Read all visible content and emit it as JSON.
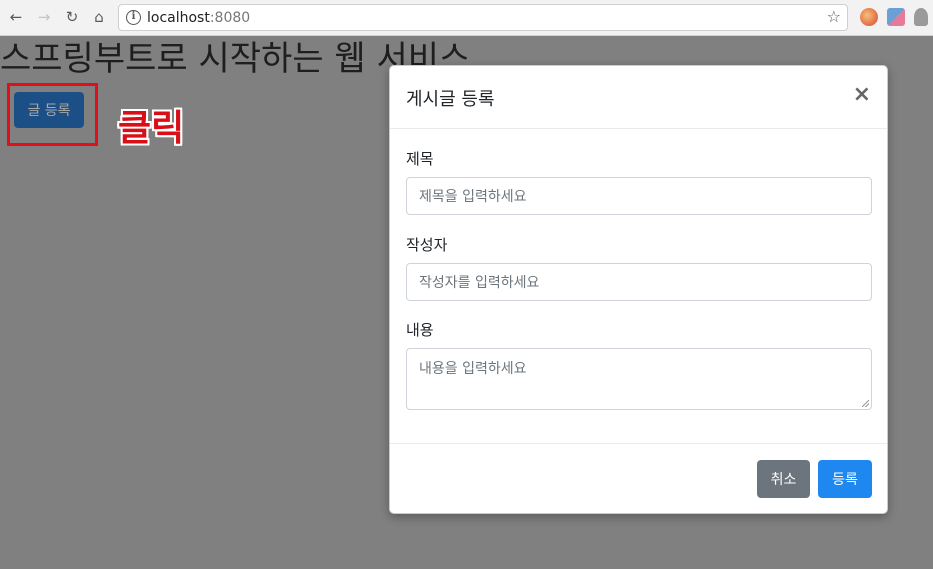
{
  "browser": {
    "url_host": "localhost",
    "url_port": ":8080",
    "back_icon": "←",
    "forward_icon": "→",
    "reload_icon": "↻",
    "home_icon": "⌂",
    "info_icon": "i",
    "star_icon": "☆"
  },
  "page": {
    "title": "스프링부트로 시작하는 웹 서비스",
    "write_button": "글 등록",
    "annotation": "클릭"
  },
  "modal": {
    "title": "게시글 등록",
    "close": "×",
    "fields": [
      {
        "label": "제목",
        "placeholder": "제목을 입력하세요"
      },
      {
        "label": "작성자",
        "placeholder": "작성자를 입력하세요"
      },
      {
        "label": "내용",
        "placeholder": "내용을 입력하세요"
      }
    ],
    "cancel_button": "취소",
    "submit_button": "등록"
  },
  "colors": {
    "overlay": "#808080",
    "primary": "#1e88f0",
    "secondary": "#6c757d",
    "highlight": "#e20f18"
  }
}
